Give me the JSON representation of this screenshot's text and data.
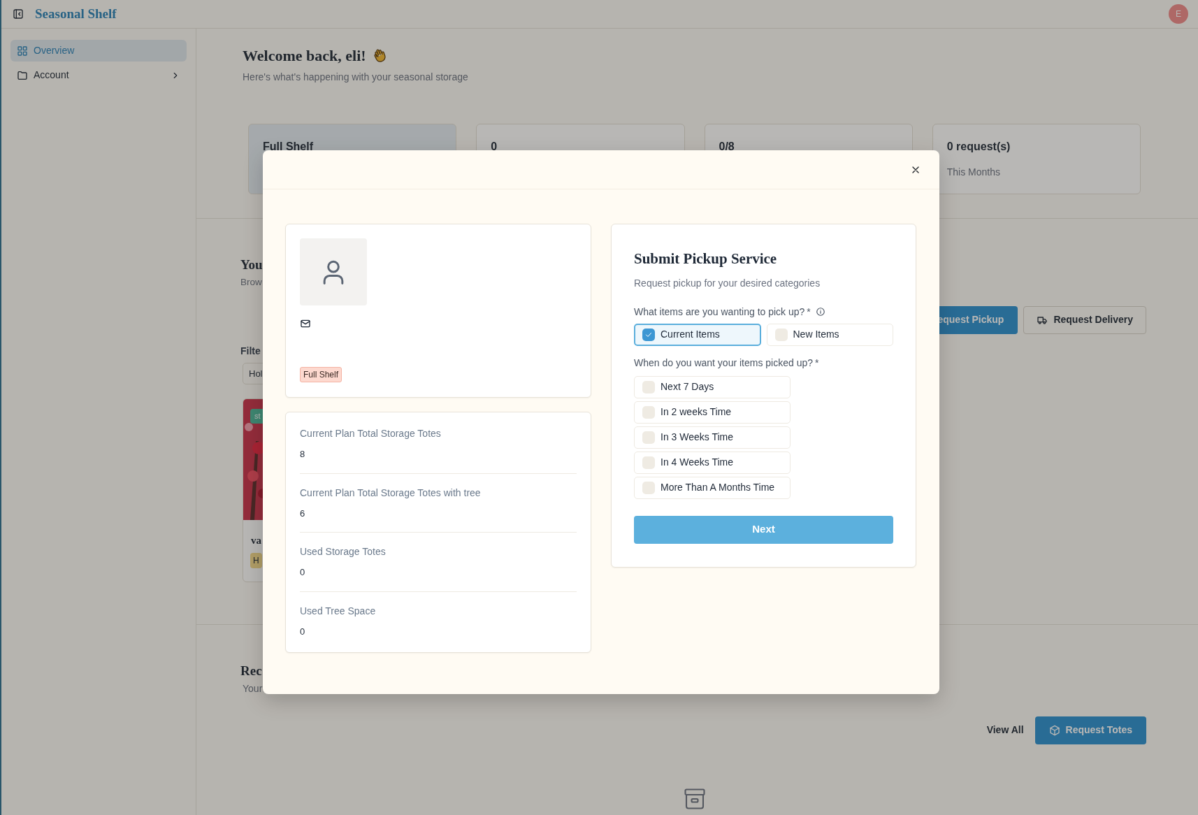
{
  "app": {
    "brand": "Seasonal Shelf",
    "avatar_initial": "E"
  },
  "sidebar": {
    "items": [
      {
        "label": "Overview",
        "kind": "grid",
        "selected": true,
        "expandable": false
      },
      {
        "label": "Account",
        "kind": "folder",
        "selected": false,
        "expandable": true
      }
    ]
  },
  "welcome": {
    "title": "Welcome back, eli!",
    "subtitle": "Here's what's happening with your seasonal storage"
  },
  "stats": [
    {
      "value": "Full Shelf",
      "selected": true
    },
    {
      "value": "0",
      "selected": false
    },
    {
      "value": "0/8",
      "selected": false
    },
    {
      "value": "0 request(s)",
      "caption": "This Months",
      "selected": false
    }
  ],
  "storage_section": {
    "title": "You",
    "subtitle": "Brow",
    "actions": [
      {
        "label": "equest Pickup",
        "kind": "primary"
      },
      {
        "label": "Request Delivery",
        "kind": "outline"
      }
    ],
    "filter_label": "Filte",
    "filter_chips": [
      "Hol"
    ],
    "items": [
      {
        "kind": "picture",
        "tag": "st",
        "title": "va",
        "category": "H"
      }
    ]
  },
  "requests_section": {
    "title": "Rec",
    "subtitle": "Your",
    "actions": [
      {
        "label": "View All",
        "kind": "link"
      },
      {
        "label": "Request Totes",
        "kind": "primary"
      }
    ]
  },
  "modal": {
    "profile": {
      "badge": "Full Shelf"
    },
    "plan_stats": [
      {
        "label": "Current Plan Total Storage Totes",
        "value": "8"
      },
      {
        "label": "Current Plan Total Storage Totes with tree",
        "value": "6"
      },
      {
        "label": "Used Storage Totes",
        "value": "0"
      },
      {
        "label": "Used Tree Space",
        "value": "0"
      }
    ],
    "form": {
      "title": "Submit Pickup Service",
      "subtitle": "Request pickup for your desired categories",
      "items_question": {
        "text": "What items are you wanting to pick up?",
        "required_mark": "*",
        "info": true
      },
      "items_options": [
        {
          "label": "Current Items",
          "checked": true
        },
        {
          "label": "New Items",
          "checked": false
        }
      ],
      "time_question": {
        "text": "When do you want your items picked up?",
        "required_mark": "*"
      },
      "time_options": [
        {
          "label": "Next 7 Days",
          "checked": false
        },
        {
          "label": "In 2 weeks Time",
          "checked": false
        },
        {
          "label": "In 3 Weeks Time",
          "checked": false
        },
        {
          "label": "In 4 Weeks Time",
          "checked": false
        },
        {
          "label": "More Than A Months Time",
          "checked": false
        }
      ],
      "submit": {
        "label": "Next",
        "disabled": true
      }
    }
  }
}
